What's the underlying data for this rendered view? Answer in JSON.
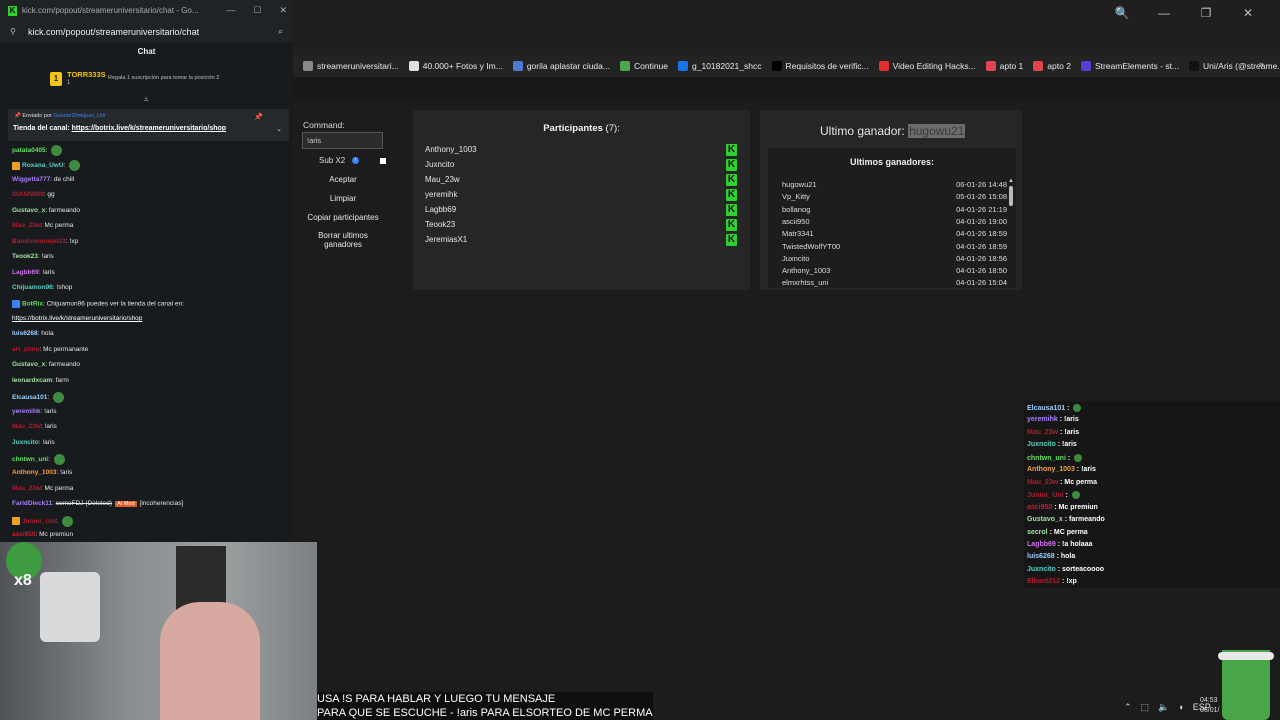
{
  "background_browser": {
    "bookmarks": [
      {
        "label": "streameruniversitari...",
        "color": "#888888"
      },
      {
        "label": "40.000+ Fotos y Im...",
        "color": "#e0e0e0"
      },
      {
        "label": "gorila aplastar ciuda...",
        "color": "#4a7bd0"
      },
      {
        "label": "Continue",
        "color": "#4ea84e"
      },
      {
        "label": "g_10182021_shcc",
        "color": "#1a73e8"
      },
      {
        "label": "Requisitos de verific...",
        "color": "#000000"
      },
      {
        "label": "Video Editing Hacks...",
        "color": "#e03030"
      },
      {
        "label": "apto 1",
        "color": "#e0464b"
      },
      {
        "label": "apto 2",
        "color": "#e0464b"
      },
      {
        "label": "StreamElements - st...",
        "color": "#5a3bd6"
      },
      {
        "label": "Uni/Aris (@streame...",
        "color": "#111111"
      }
    ],
    "window_controls": [
      "🔍",
      "—",
      "❐",
      "✕"
    ],
    "toolbar_icons": [
      "⌕",
      "✎",
      "📷",
      "⛨",
      "⚙",
      "▷",
      "♥",
      "⬇",
      "☰",
      "👤",
      "◆",
      "⬢",
      "AI"
    ]
  },
  "giveaway_app": {
    "command_label": "Command:",
    "command_value": "!aris",
    "sub_label": "Sub X2",
    "buttons": [
      "Aceptar",
      "Limpiar",
      "Copiar participantes"
    ],
    "clear_winners_button": [
      "Borrar ultimos",
      "ganadores"
    ],
    "participants_title": "Participantes",
    "participants_count": "(7):",
    "participants": [
      "Anthony_1003",
      "Juxncito",
      "Mau_23w",
      "yeremihk",
      "Lagbb69",
      "Teook23",
      "JeremiasX1"
    ],
    "last_winner_label": "Ultimo ganador:",
    "last_winner": "hugowu21",
    "winners_title": "Ultimos ganadores:",
    "winners": [
      {
        "name": "hugowu21",
        "date": "06-01-26 14:48"
      },
      {
        "name": "Vp_Kitty",
        "date": "05-01-26 15:08"
      },
      {
        "name": "bollanog",
        "date": "04-01-26 21:19"
      },
      {
        "name": "ascii950",
        "date": "04-01-26 19:00"
      },
      {
        "name": "Matr3341",
        "date": "04-01-26 18:59"
      },
      {
        "name": "TwistedWolfYT00",
        "date": "04-01-26 18:59"
      },
      {
        "name": "Juxncito",
        "date": "04-01-26 18:56"
      },
      {
        "name": "Anthony_1003",
        "date": "04-01-26 18:50"
      },
      {
        "name": "elmxrhtss_uni",
        "date": "04-01-26 15:04"
      }
    ]
  },
  "overlay_chat": [
    {
      "user": "Elcausa101",
      "msg": "",
      "color": "#9ad0ff",
      "emote": true
    },
    {
      "user": "yeremihk",
      "msg": "!aris",
      "color": "#a97cff"
    },
    {
      "user": "Mau_23w",
      "msg": "!aris",
      "color": "#b01c2e"
    },
    {
      "user": "Juxncito",
      "msg": "!aris",
      "color": "#54d1c5"
    },
    {
      "user": "chntwn_uni",
      "msg": "",
      "color": "#5ee05e",
      "emote": true
    },
    {
      "user": "Anthony_1003",
      "msg": "!aris",
      "color": "#f0a040"
    },
    {
      "user": "Mau_23w",
      "msg": "Mc perma",
      "color": "#b01c2e"
    },
    {
      "user": "Junior_Uni",
      "msg": "",
      "color": "#b01c2e",
      "emote": true
    },
    {
      "user": "asci950",
      "msg": "Mc premiun",
      "color": "#d01c2e"
    },
    {
      "user": "Gustavo_x",
      "msg": "farmeando",
      "color": "#9fe0a0"
    },
    {
      "user": "secrol",
      "msg": "MC perma",
      "color": "#9fe0a0"
    },
    {
      "user": "Lagbb69",
      "msg": "!a holaaa",
      "color": "#d070f0"
    },
    {
      "user": "luis6268",
      "msg": "hola",
      "color": "#9ad0ff"
    },
    {
      "user": "Juxncito",
      "msg": "sorteacoooo",
      "color": "#54d1c5"
    },
    {
      "user": "Elbant212",
      "msg": "!xp",
      "color": "#b01c2e"
    }
  ],
  "popout_chat": {
    "window_title": "kick.com/popout/streameruniversitario/chat - Go...",
    "address": "kick.com/popout/streameruniversitario/chat",
    "chat_title": "Chat",
    "sub_banner": {
      "user": "TORR333S",
      "count": "1",
      "text": "Regala 1 suscripción para tomar la posición 2"
    },
    "pinned": {
      "sent_by_label": "Enviado por",
      "sent_by_user": "Gunnar20miguel_Uni",
      "message_label": "Tienda del canal:",
      "message_link": "https://botrix.live/k/streameruniversitario/shop"
    },
    "messages": [
      {
        "user": "patata0405",
        "msg": "",
        "color": "#5ee05e",
        "emote": true
      },
      {
        "user": "Roxana_UwU",
        "msg": "",
        "color": "#54d1c5",
        "emote": true,
        "badge": "#f0a020"
      },
      {
        "user": "Wiggetta777",
        "msg": "de chill",
        "color": "#a97cff"
      },
      {
        "user": "GIANN809",
        "msg": "gg",
        "color": "#b01c2e"
      },
      {
        "user": "Gustavo_x",
        "msg": "farmeando",
        "color": "#9fe0a0"
      },
      {
        "user": "Mau_23w",
        "msg": "Mc perma",
        "color": "#b01c2e"
      },
      {
        "user": "Bandoneonejel23",
        "msg": "!xp",
        "color": "#b01c2e"
      },
      {
        "user": "Teook23",
        "msg": "!aris",
        "color": "#9fe0a0"
      },
      {
        "user": "Lagbb69",
        "msg": "!aris",
        "color": "#d070f0"
      },
      {
        "user": "Chijuamon96",
        "msg": "!shop",
        "color": "#54d1c5"
      },
      {
        "user": "BotRix",
        "msg": "Chijuamon96 puedes ver la tienda del canal en:",
        "color": "#5ee05e",
        "badge": "#3b82f6"
      },
      {
        "user": "",
        "msg": "https://botrix.live/k/streameruniversitario/shop",
        "color": "#ffffff",
        "link": true
      },
      {
        "user": "luis6268",
        "msg": "hola",
        "color": "#9ad0ff"
      },
      {
        "user": "art_pimo",
        "msg": "Mc permanante",
        "color": "#b01c2e"
      },
      {
        "user": "Gustavo_x",
        "msg": "farmeando",
        "color": "#9fe0a0"
      },
      {
        "user": "leonardxcam",
        "msg": "farm",
        "color": "#9fe0a0"
      },
      {
        "user": "Elcausa101",
        "msg": "",
        "color": "#9ad0ff",
        "emote": true
      },
      {
        "user": "yeremihk",
        "msg": "!aris",
        "color": "#a97cff"
      },
      {
        "user": "Mau_23w",
        "msg": "!aris",
        "color": "#b01c2e"
      },
      {
        "user": "Juxncito",
        "msg": "!aris",
        "color": "#54d1c5"
      },
      {
        "user": "chntwn_uni",
        "msg": "",
        "color": "#5ee05e",
        "emote": true
      },
      {
        "user": "Anthony_1003",
        "msg": "!aris",
        "color": "#f0a040"
      },
      {
        "user": "Mau_23w",
        "msg": "Mc perma",
        "color": "#b01c2e"
      },
      {
        "user": "FaridDieck11",
        "msg": "comoFDJ (Deleted)",
        "mod_tag": "AI Mod",
        "extra": "[incoherencias]",
        "color": "#a97cff"
      },
      {
        "user": "Junior_Uni",
        "msg": "",
        "color": "#b01c2e",
        "emote": true,
        "badge": "#f0a020"
      },
      {
        "user": "asci950",
        "msg": "Mc premiun",
        "color": "#d01c2e"
      }
    ]
  },
  "webcam_overlay": {
    "count_badge": "x8"
  },
  "caption": {
    "line1": "USA !S PARA HABLAR Y LUEGO TU MENSAJE",
    "line2": "PARA QUE SE ESCUCHE - !aris PARA ELSORTEO DE MC PERMA"
  },
  "taskbar": {
    "lang": "ESP",
    "time": "04:53",
    "date": "06/01/"
  }
}
